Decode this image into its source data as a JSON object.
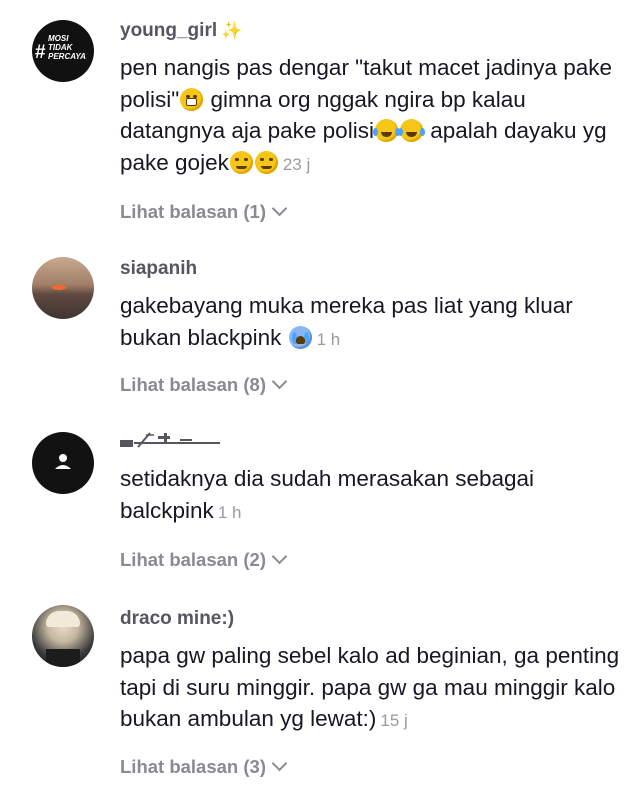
{
  "comments": [
    {
      "username": "young_girl",
      "avatar_lines": [
        "MOSI",
        "TIDAK",
        "PERCAYA"
      ],
      "text_segments": [
        "pen nangis pas dengar \"takut macet jadinya pake polisi\"",
        " gimna org nggak ngira bp kalau datangnya aja pake polisi",
        " apalah dayaku yg pake gojek"
      ],
      "time": "23 j",
      "replies": "Lihat balasan (1)"
    },
    {
      "username": "siapanih",
      "text": "gakebayang muka mereka pas liat yang kluar bukan blackpink",
      "time": "1 h",
      "replies": "Lihat balasan (8)"
    },
    {
      "username": "",
      "text": "setidaknya dia sudah merasakan sebagai balckpink",
      "time": "1 h",
      "replies": "Lihat balasan (2)"
    },
    {
      "username": "draco mine:)",
      "text": "papa gw paling sebel kalo ad beginian, ga penting tapi di suru minggir. papa gw ga mau minggir kalo bukan ambulan yg lewat:)",
      "time": "15 j",
      "replies": "Lihat balasan (3)"
    }
  ],
  "colors": {
    "username": "#555660",
    "text": "#161823",
    "time": "#9a9ba1",
    "replies": "#8a8b91",
    "background": "#ffffff"
  },
  "icons": [
    "sparkle-icon",
    "grimace-emoji",
    "laugh-cry-emoji",
    "relieved-emoji",
    "wail-emoji",
    "default-avatar-icon",
    "chevron-down-icon"
  ]
}
